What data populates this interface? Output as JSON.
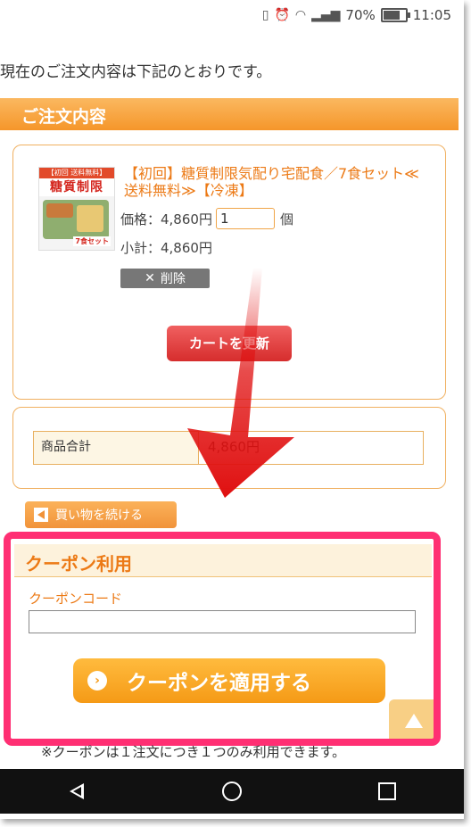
{
  "status_bar": {
    "battery": "70%",
    "time": "11:05",
    "battery_level": 0.7
  },
  "intro_text": "現在のご注文内容は下記のとおりです。",
  "order_section": {
    "title": "ご注文内容"
  },
  "item": {
    "image_banner": "【初回 送料無料】",
    "image_title": "糖質制限",
    "image_badge": "7食セット",
    "name": "【初回】糖質制限気配り宅配食／7食セット≪送料無料≫【冷凍】",
    "price_label": "価格：4,860円",
    "quantity": "1",
    "quantity_unit": "個",
    "subtotal_label": "小計：4,860円",
    "delete_label": "削除"
  },
  "cart_update_label": "カートを更新",
  "totals": {
    "label": "商品合計",
    "value": "4,860円"
  },
  "continue_shopping_label": "買い物を続ける",
  "coupon": {
    "title": "クーポン利用",
    "code_label": "クーポンコード",
    "code_value": "",
    "apply_label": "クーポンを適用する",
    "note": "※クーポンは１注文につき１つのみ利用できます。"
  },
  "colors": {
    "accent": "#f5962a",
    "highlight": "#ff2f73",
    "arrow": "#e01010"
  }
}
